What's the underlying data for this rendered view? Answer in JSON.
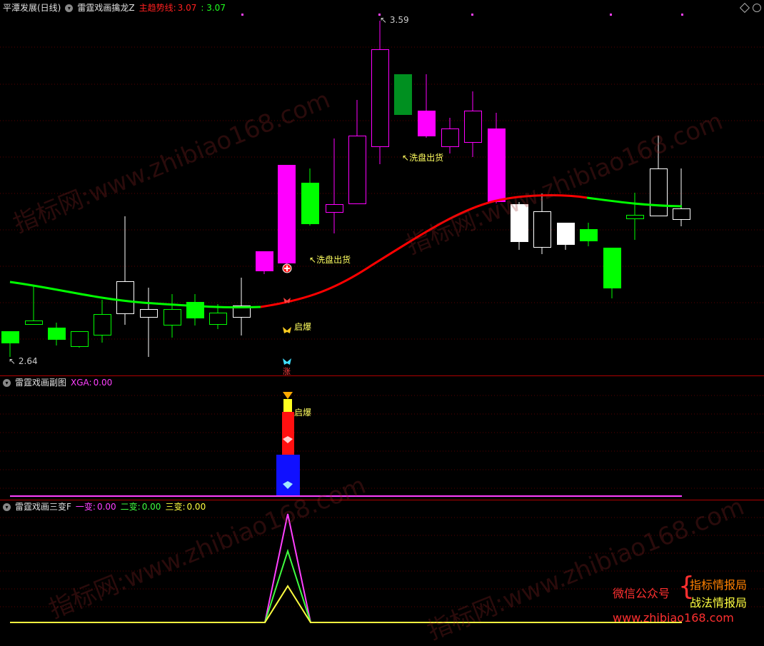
{
  "main": {
    "stock_name": "平潭发展(日线)",
    "indicator_name": "雷霆戏画擒龙Z",
    "trend_label": "主趋势线:",
    "trend_value_a": "3.07",
    "trend_value_b": "3.07",
    "high_label": "3.59",
    "low_label": "2.64",
    "annotation_1": "洗盘出货",
    "annotation_2": "洗盘出货",
    "annotation_3": "启爆",
    "annotation_4": "涨"
  },
  "sub1": {
    "name": "雷霆戏画副图",
    "xga_label": "XGA:",
    "xga_value": "0.00",
    "annotation": "启爆"
  },
  "sub2": {
    "name": "雷霆戏画三变F",
    "v1_label": "一变:",
    "v1_value": "0.00",
    "v2_label": "二变:",
    "v2_value": "0.00",
    "v3_label": "三变:",
    "v3_value": "0.00"
  },
  "watermark": {
    "url": "www.zhibiao168.com",
    "cn": "指标网:"
  },
  "brand": {
    "wechat": "微信公众号",
    "name1": "指标情报局",
    "name2": "战法情报局",
    "url": "www.zhibiao168.com"
  },
  "colors": {
    "up": "#ff00ff",
    "down": "#00ff00",
    "neutral": "#ffffff",
    "separator": "#b00000",
    "trend_up": "#ff0000",
    "trend_down": "#00ff00"
  }
}
